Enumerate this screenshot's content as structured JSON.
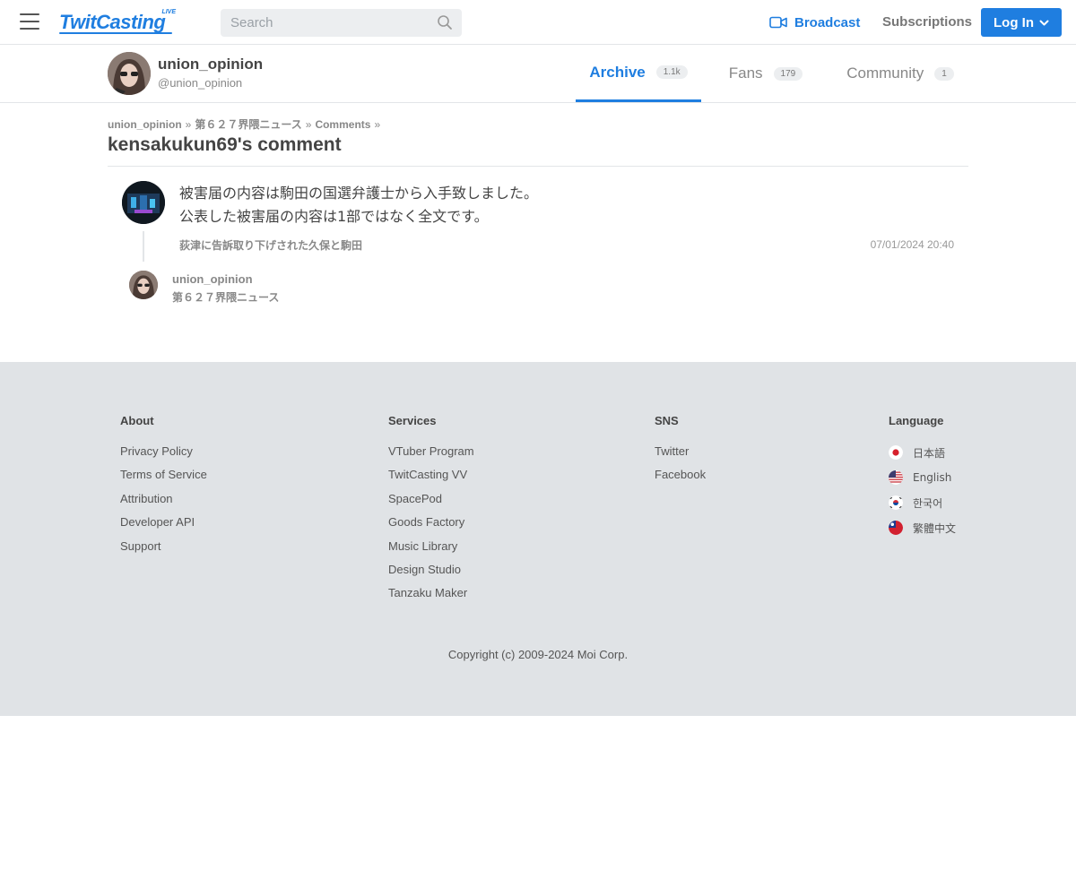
{
  "header": {
    "logo_text": "TwitCasting",
    "logo_badge": "LIVE",
    "search_placeholder": "Search",
    "broadcast_label": "Broadcast",
    "subscriptions_label": "Subscriptions",
    "login_label": "Log In",
    "accent_color": "#1f7ee0"
  },
  "profile": {
    "name": "union_opinion",
    "handle": "@union_opinion",
    "tabs": [
      {
        "label": "Archive",
        "count": "1.1k",
        "active": true
      },
      {
        "label": "Fans",
        "count": "179",
        "active": false
      },
      {
        "label": "Community",
        "count": "1",
        "active": false
      }
    ]
  },
  "breadcrumb": {
    "items": [
      "union_opinion",
      "第６２７界隈ニュース",
      "Comments"
    ],
    "separator": "»"
  },
  "page_title": "kensakukun69's comment",
  "comment": {
    "line1": "被害届の内容は駒田の国選弁護士から入手致しました。",
    "line2": "公表した被害届の内容は1部ではなく全文です。",
    "movie_title": "荻津に告訴取り下げされた久保と駒田",
    "date": "07/01/2024 20:40"
  },
  "reply": {
    "user": "union_opinion",
    "title": "第６２７界隈ニュース"
  },
  "footer": {
    "about": {
      "heading": "About",
      "links": [
        "Privacy Policy",
        "Terms of Service",
        "Attribution",
        "Developer API",
        "Support"
      ]
    },
    "services": {
      "heading": "Services",
      "links": [
        "VTuber Program",
        "TwitCasting VV",
        "SpacePod",
        "Goods Factory",
        "Music Library",
        "Design Studio",
        "Tanzaku Maker"
      ]
    },
    "sns": {
      "heading": "SNS",
      "links": [
        "Twitter",
        "Facebook"
      ]
    },
    "language": {
      "heading": "Language",
      "items": [
        "日本語",
        "English",
        "한국어",
        "繁體中文"
      ]
    },
    "copyright": "Copyright (c) 2009-2024 Moi Corp."
  }
}
